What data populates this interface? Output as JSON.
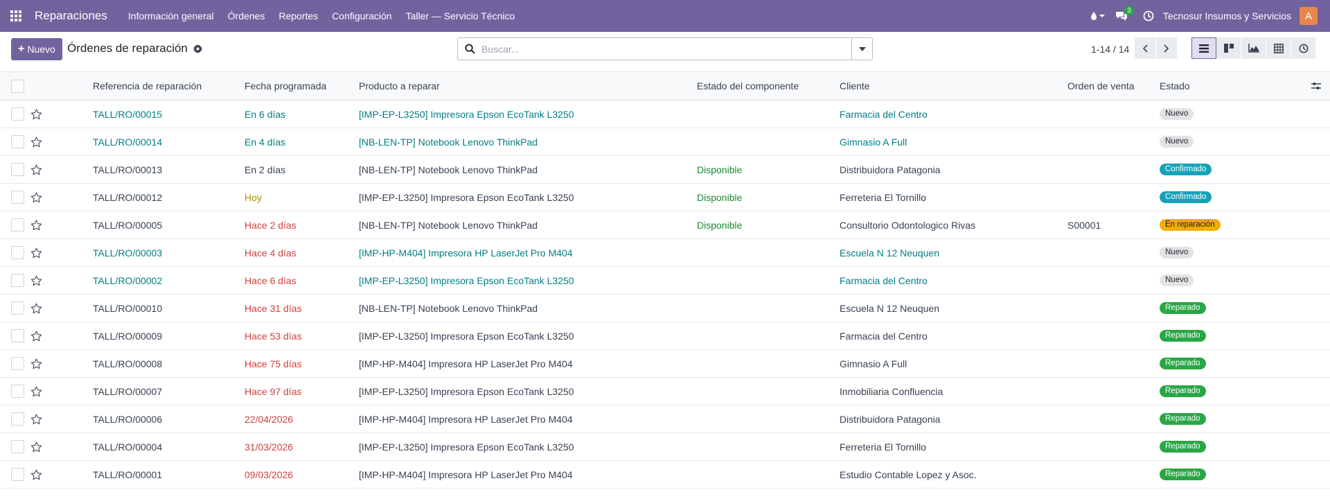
{
  "navbar": {
    "app_name": "Reparaciones",
    "menu": [
      {
        "label": "Información general"
      },
      {
        "label": "Órdenes"
      },
      {
        "label": "Reportes"
      },
      {
        "label": "Configuración"
      },
      {
        "label": "Taller — Servicio Técnico"
      }
    ],
    "messages_count": "3",
    "company": "Tecnosur Insumos y Servicios",
    "avatar_letter": "A",
    "colors": {
      "bar": "#71639e",
      "avatar": "#e8874d",
      "badge": "#28a745"
    }
  },
  "control": {
    "new_label": "Nuevo",
    "title": "Órdenes de reparación",
    "search_placeholder": "Buscar...",
    "pager": "1-14 / 14",
    "views": [
      "list-view-icon",
      "kanban-view-icon",
      "graph-view-icon",
      "pivot-view-icon",
      "activity-view-icon"
    ],
    "active_view": "list"
  },
  "table": {
    "columns": {
      "ref": "Referencia de reparación",
      "date": "Fecha programada",
      "product": "Producto a reparar",
      "component": "Estado del componente",
      "client": "Cliente",
      "order": "Orden de venta",
      "state": "Estado"
    },
    "rows": [
      {
        "ref": "TALL/RO/00015",
        "date": "En 6 días",
        "date_style": "link",
        "product": "[IMP-EP-L3250] Impresora Epson EcoTank L3250",
        "component": "",
        "client": "Farmacia del Centro",
        "order": "",
        "state": "Nuevo",
        "state_style": "new",
        "text_style": "link"
      },
      {
        "ref": "TALL/RO/00014",
        "date": "En 4 días",
        "date_style": "link",
        "product": "[NB-LEN-TP] Notebook Lenovo ThinkPad",
        "component": "",
        "client": "Gimnasio A Full",
        "order": "",
        "state": "Nuevo",
        "state_style": "new",
        "text_style": "link"
      },
      {
        "ref": "TALL/RO/00013",
        "date": "En 2 días",
        "date_style": "plain",
        "product": "[NB-LEN-TP] Notebook Lenovo ThinkPad",
        "component": "Disponible",
        "client": "Distribuidora Patagonia",
        "order": "",
        "state": "Confirmado",
        "state_style": "conf",
        "text_style": "plain"
      },
      {
        "ref": "TALL/RO/00012",
        "date": "Hoy",
        "date_style": "orange",
        "product": "[IMP-EP-L3250] Impresora Epson EcoTank L3250",
        "component": "Disponible",
        "client": "Ferreteria El Tornillo",
        "order": "",
        "state": "Confirmado",
        "state_style": "conf",
        "text_style": "plain"
      },
      {
        "ref": "TALL/RO/00005",
        "date": "Hace 2 días",
        "date_style": "red",
        "product": "[NB-LEN-TP] Notebook Lenovo ThinkPad",
        "component": "Disponible",
        "client": "Consultorio Odontologico Rivas",
        "order": "S00001",
        "state": "En reparación",
        "state_style": "rep",
        "text_style": "plain"
      },
      {
        "ref": "TALL/RO/00003",
        "date": "Hace 4 días",
        "date_style": "red",
        "product": "[IMP-HP-M404] Impresora HP LaserJet Pro M404",
        "component": "",
        "client": "Escuela N 12 Neuquen",
        "order": "",
        "state": "Nuevo",
        "state_style": "new",
        "text_style": "link"
      },
      {
        "ref": "TALL/RO/00002",
        "date": "Hace 6 días",
        "date_style": "red",
        "product": "[IMP-EP-L3250] Impresora Epson EcoTank L3250",
        "component": "",
        "client": "Farmacia del Centro",
        "order": "",
        "state": "Nuevo",
        "state_style": "new",
        "text_style": "link"
      },
      {
        "ref": "TALL/RO/00010",
        "date": "Hace 31 días",
        "date_style": "red",
        "product": "[NB-LEN-TP] Notebook Lenovo ThinkPad",
        "component": "",
        "client": "Escuela N 12 Neuquen",
        "order": "",
        "state": "Reparado",
        "state_style": "done",
        "text_style": "plain"
      },
      {
        "ref": "TALL/RO/00009",
        "date": "Hace 53 días",
        "date_style": "red",
        "product": "[IMP-EP-L3250] Impresora Epson EcoTank L3250",
        "component": "",
        "client": "Farmacia del Centro",
        "order": "",
        "state": "Reparado",
        "state_style": "done",
        "text_style": "plain"
      },
      {
        "ref": "TALL/RO/00008",
        "date": "Hace 75 días",
        "date_style": "red",
        "product": "[IMP-HP-M404] Impresora HP LaserJet Pro M404",
        "component": "",
        "client": "Gimnasio A Full",
        "order": "",
        "state": "Reparado",
        "state_style": "done",
        "text_style": "plain"
      },
      {
        "ref": "TALL/RO/00007",
        "date": "Hace 97 días",
        "date_style": "red",
        "product": "[IMP-EP-L3250] Impresora Epson EcoTank L3250",
        "component": "",
        "client": "Inmobiliaria Confluencia",
        "order": "",
        "state": "Reparado",
        "state_style": "done",
        "text_style": "plain"
      },
      {
        "ref": "TALL/RO/00006",
        "date": "22/04/2026",
        "date_style": "red",
        "product": "[IMP-HP-M404] Impresora HP LaserJet Pro M404",
        "component": "",
        "client": "Distribuidora Patagonia",
        "order": "",
        "state": "Reparado",
        "state_style": "done",
        "text_style": "plain"
      },
      {
        "ref": "TALL/RO/00004",
        "date": "31/03/2026",
        "date_style": "red",
        "product": "[IMP-EP-L3250] Impresora Epson EcoTank L3250",
        "component": "",
        "client": "Ferreteria El Tornillo",
        "order": "",
        "state": "Reparado",
        "state_style": "done",
        "text_style": "plain"
      },
      {
        "ref": "TALL/RO/00001",
        "date": "09/03/2026",
        "date_style": "red",
        "product": "[IMP-HP-M404] Impresora HP LaserJet Pro M404",
        "component": "",
        "client": "Estudio Contable Lopez y Asoc.",
        "order": "",
        "state": "Reparado",
        "state_style": "done",
        "text_style": "plain"
      }
    ]
  }
}
